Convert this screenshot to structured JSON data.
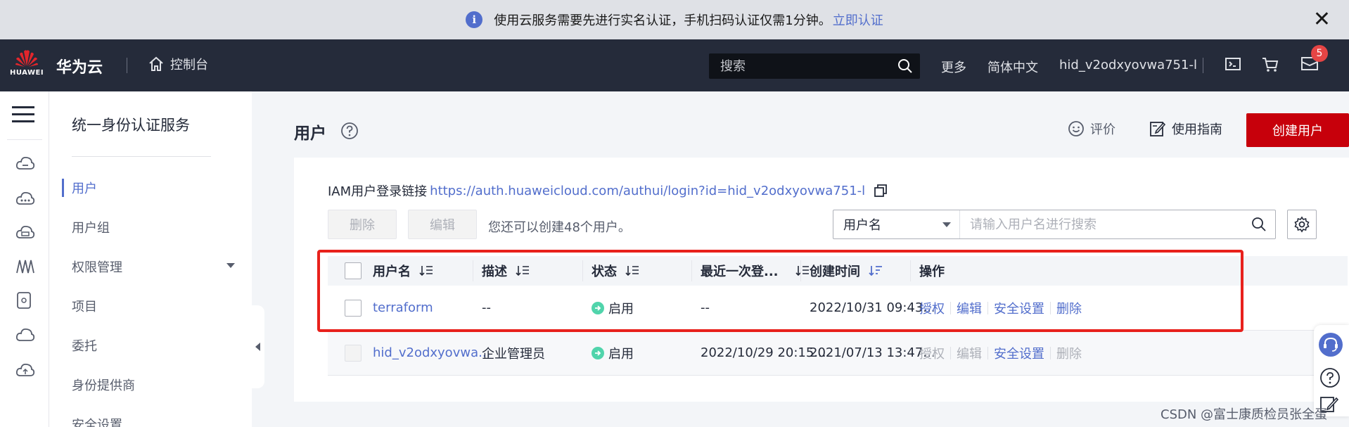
{
  "notice": {
    "text": "使用云服务需要先进行实名认证，手机扫码认证仅需1分钟。",
    "link": "立即认证"
  },
  "header": {
    "logo_text": "HUAWEI",
    "brand": "华为云",
    "console": "控制台",
    "search_placeholder": "搜索",
    "more": "更多",
    "language": "简体中文",
    "account": "hid_v2odxyovwa751-l",
    "message_badge": "5"
  },
  "sidebar": {
    "title": "统一身份认证服务",
    "items": [
      {
        "label": "用户",
        "active": true
      },
      {
        "label": "用户组"
      },
      {
        "label": "权限管理",
        "expandable": true
      },
      {
        "label": "项目"
      },
      {
        "label": "委托"
      },
      {
        "label": "身份提供商"
      },
      {
        "label": "安全设置"
      }
    ]
  },
  "page": {
    "title": "用户",
    "actions": {
      "rate": "评价",
      "guide": "使用指南",
      "create": "创建用户"
    }
  },
  "card": {
    "login_label": "IAM用户登录链接",
    "login_url": "https://auth.huaweicloud.com/authui/login?id=hid_v2odxyovwa751-l",
    "delete": "删除",
    "edit": "编辑",
    "hint": "您还可以创建48个用户。",
    "filter_field": "用户名",
    "search_placeholder": "请输入用户名进行搜索"
  },
  "table": {
    "columns": [
      "用户名",
      "描述",
      "状态",
      "最近一次登...",
      "创建时间",
      "操作"
    ],
    "rows": [
      {
        "username": "terraform",
        "description": "--",
        "status": "启用",
        "last_login": "--",
        "created": "2022/10/31 09:43...",
        "ops": [
          "授权",
          "编辑",
          "安全设置",
          "删除"
        ],
        "ops_enabled": [
          true,
          true,
          true,
          true
        ]
      },
      {
        "username": "hid_v2odxyovwa...",
        "description": "企业管理员",
        "status": "启用",
        "last_login": "2022/10/29 20:15...",
        "created": "2021/07/13 13:47...",
        "ops": [
          "授权",
          "编辑",
          "安全设置",
          "删除"
        ],
        "ops_enabled": [
          false,
          false,
          true,
          false
        ]
      }
    ]
  },
  "watermark": "CSDN @富士康质检员张全蛋",
  "colors": {
    "accent": "#526ecc",
    "brand_red": "#c7000b",
    "highlight": "#e8211c",
    "header_bg": "#252b3a"
  }
}
